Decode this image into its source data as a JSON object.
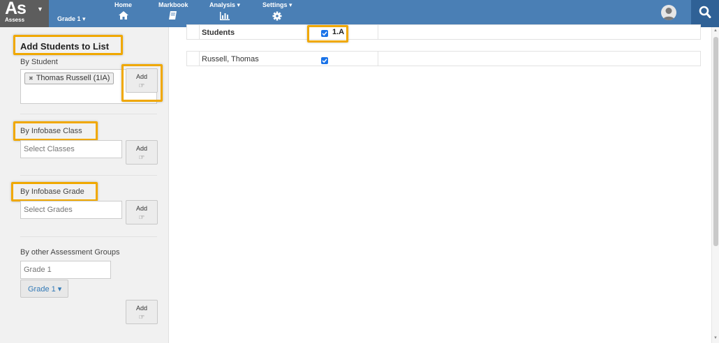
{
  "app": {
    "logo": "As",
    "logo_sub": "Assess",
    "grade_selector": "Grade 1 ▾"
  },
  "nav": {
    "home": "Home",
    "markbook": "Markbook",
    "analysis": "Analysis ▾",
    "settings": "Settings ▾"
  },
  "sidebar": {
    "title": "Add Students to List",
    "by_student": {
      "label": "By Student",
      "selected_tag": "Thomas Russell (1IA)",
      "add_label": "Add"
    },
    "by_class": {
      "label": "By Infobase Class",
      "placeholder": "Select Classes",
      "add_label": "Add"
    },
    "by_grade": {
      "label": "By Infobase Grade",
      "placeholder": "Select Grades",
      "add_label": "Add"
    },
    "by_group": {
      "label": "By other Assessment Groups",
      "placeholder": "Grade 1",
      "dropdown_value": "Grade 1 ▾",
      "add_label": "Add"
    }
  },
  "table": {
    "header_label": "Students",
    "class_column": "1.A",
    "rows": [
      {
        "name": "Russell, Thomas",
        "checked": true
      }
    ]
  },
  "colors": {
    "topbar": "#4a7fb5",
    "logo_bg": "#5d5d5d",
    "search_bg": "#2f6196",
    "highlight": "#f0a800",
    "checkbox": "#1a73e8"
  }
}
